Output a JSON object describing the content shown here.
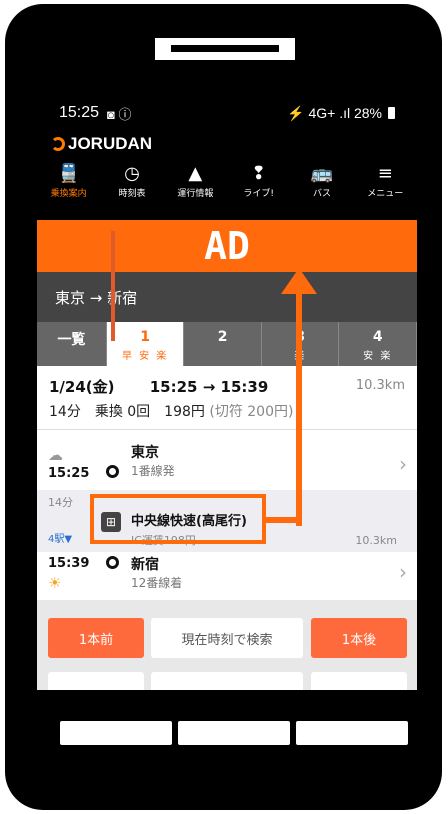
{
  "status": {
    "time": "15:25",
    "icons": "◙ ⓘ",
    "right": "⚡ 4G+ .ıl 28%"
  },
  "app": {
    "logo": "JORUDAN"
  },
  "tabs": [
    {
      "label": "乗換案内",
      "icon": "train-icon",
      "glyph": "🚆"
    },
    {
      "label": "時刻表",
      "icon": "timetable-icon",
      "glyph": "◷"
    },
    {
      "label": "運行情報",
      "icon": "warning-icon",
      "glyph": "▲"
    },
    {
      "label": "ライブ!",
      "icon": "live-icon",
      "glyph": "❢"
    },
    {
      "label": "バス",
      "icon": "bus-icon",
      "glyph": "🚌"
    },
    {
      "label": "メニュー",
      "icon": "menu-icon",
      "glyph": "≡"
    }
  ],
  "ad": "AD",
  "route": "東京 → 新宿",
  "result_tabs": [
    {
      "label": "一覧",
      "sub": ""
    },
    {
      "label": "1",
      "sub": "早 安 楽"
    },
    {
      "label": "2",
      "sub": ""
    },
    {
      "label": "3",
      "sub": "楽"
    },
    {
      "label": "4",
      "sub": "安 楽"
    }
  ],
  "summary": {
    "date": "1/24(金)",
    "times": "15:25 → 15:39",
    "distance": "10.3km",
    "line2": "14分　乗換 0回　198円",
    "line2_grey": "(切符 200円)"
  },
  "detail": {
    "from_station": "東京",
    "from_platform": "1番線発",
    "from_time": "15:25",
    "duration": "14分",
    "stations": "4駅▼",
    "train": "中央線快速(高尾行)",
    "fare": "IC運賃198円",
    "leg_distance": "10.3km",
    "to_station": "新宿",
    "to_platform": "12番線着",
    "to_time": "15:39"
  },
  "buttons": {
    "prev": "1本前",
    "now": "現在時刻で検索",
    "next": "1本後"
  },
  "colors": {
    "accent": "#ff6a0d",
    "line": "#e05a2a"
  }
}
